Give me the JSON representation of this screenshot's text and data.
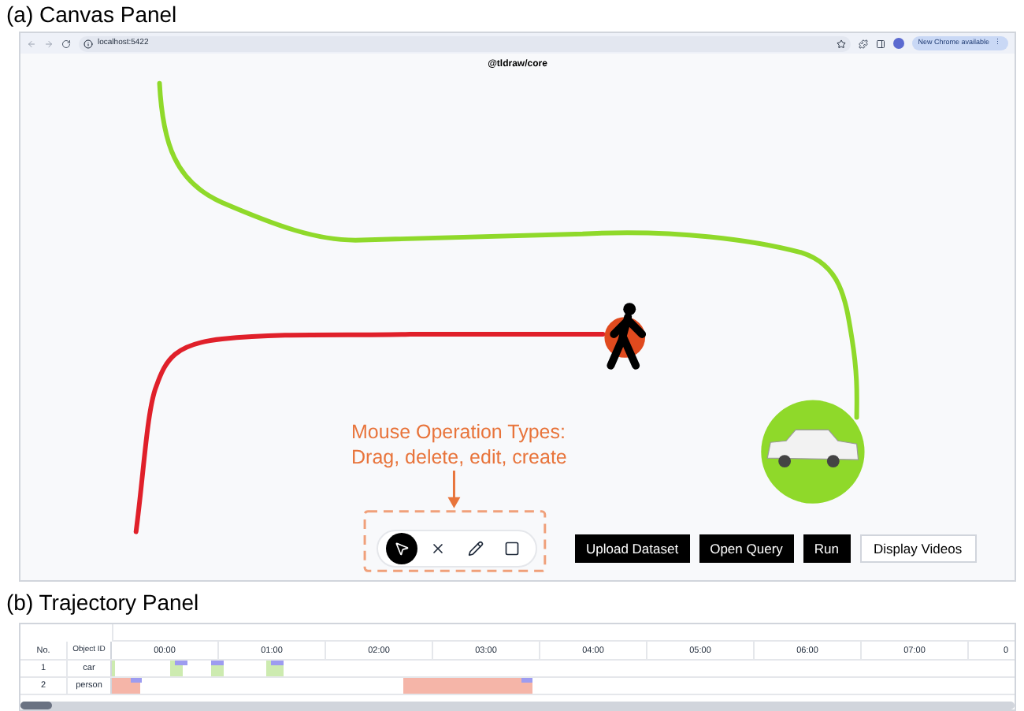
{
  "canvas_panel": {
    "caption": "(a) Canvas Panel",
    "browser": {
      "url": "localhost:5422",
      "update_badge": "New Chrome available",
      "menu_glyph": "⋮"
    },
    "page_title": "@tldraw/core",
    "annotation": {
      "lines": [
        "Mouse Operation Types:",
        "Drag, delete, edit, create"
      ]
    },
    "tools": [
      {
        "kind": "select",
        "selected": true
      },
      {
        "kind": "delete",
        "selected": false
      },
      {
        "kind": "edit",
        "selected": false
      },
      {
        "kind": "create",
        "selected": false
      }
    ],
    "buttons": [
      {
        "label": "Upload Dataset",
        "kind": "primary"
      },
      {
        "label": "Open Query",
        "kind": "primary"
      },
      {
        "label": "Run",
        "kind": "primary"
      },
      {
        "label": "Display Videos",
        "kind": "secondary"
      }
    ]
  },
  "trajectory_panel": {
    "caption": "(b) Trajectory Panel",
    "columns": [
      "No.",
      "Object ID"
    ],
    "time_ticks": [
      "00:00",
      "01:00",
      "02:00",
      "03:00",
      "04:00",
      "05:00",
      "06:00",
      "07:00",
      "0"
    ],
    "rows": [
      {
        "no": "1",
        "object_id": "car",
        "color": "#cdebb0"
      },
      {
        "no": "2",
        "object_id": "person",
        "color": "#f5b5a8"
      }
    ]
  }
}
